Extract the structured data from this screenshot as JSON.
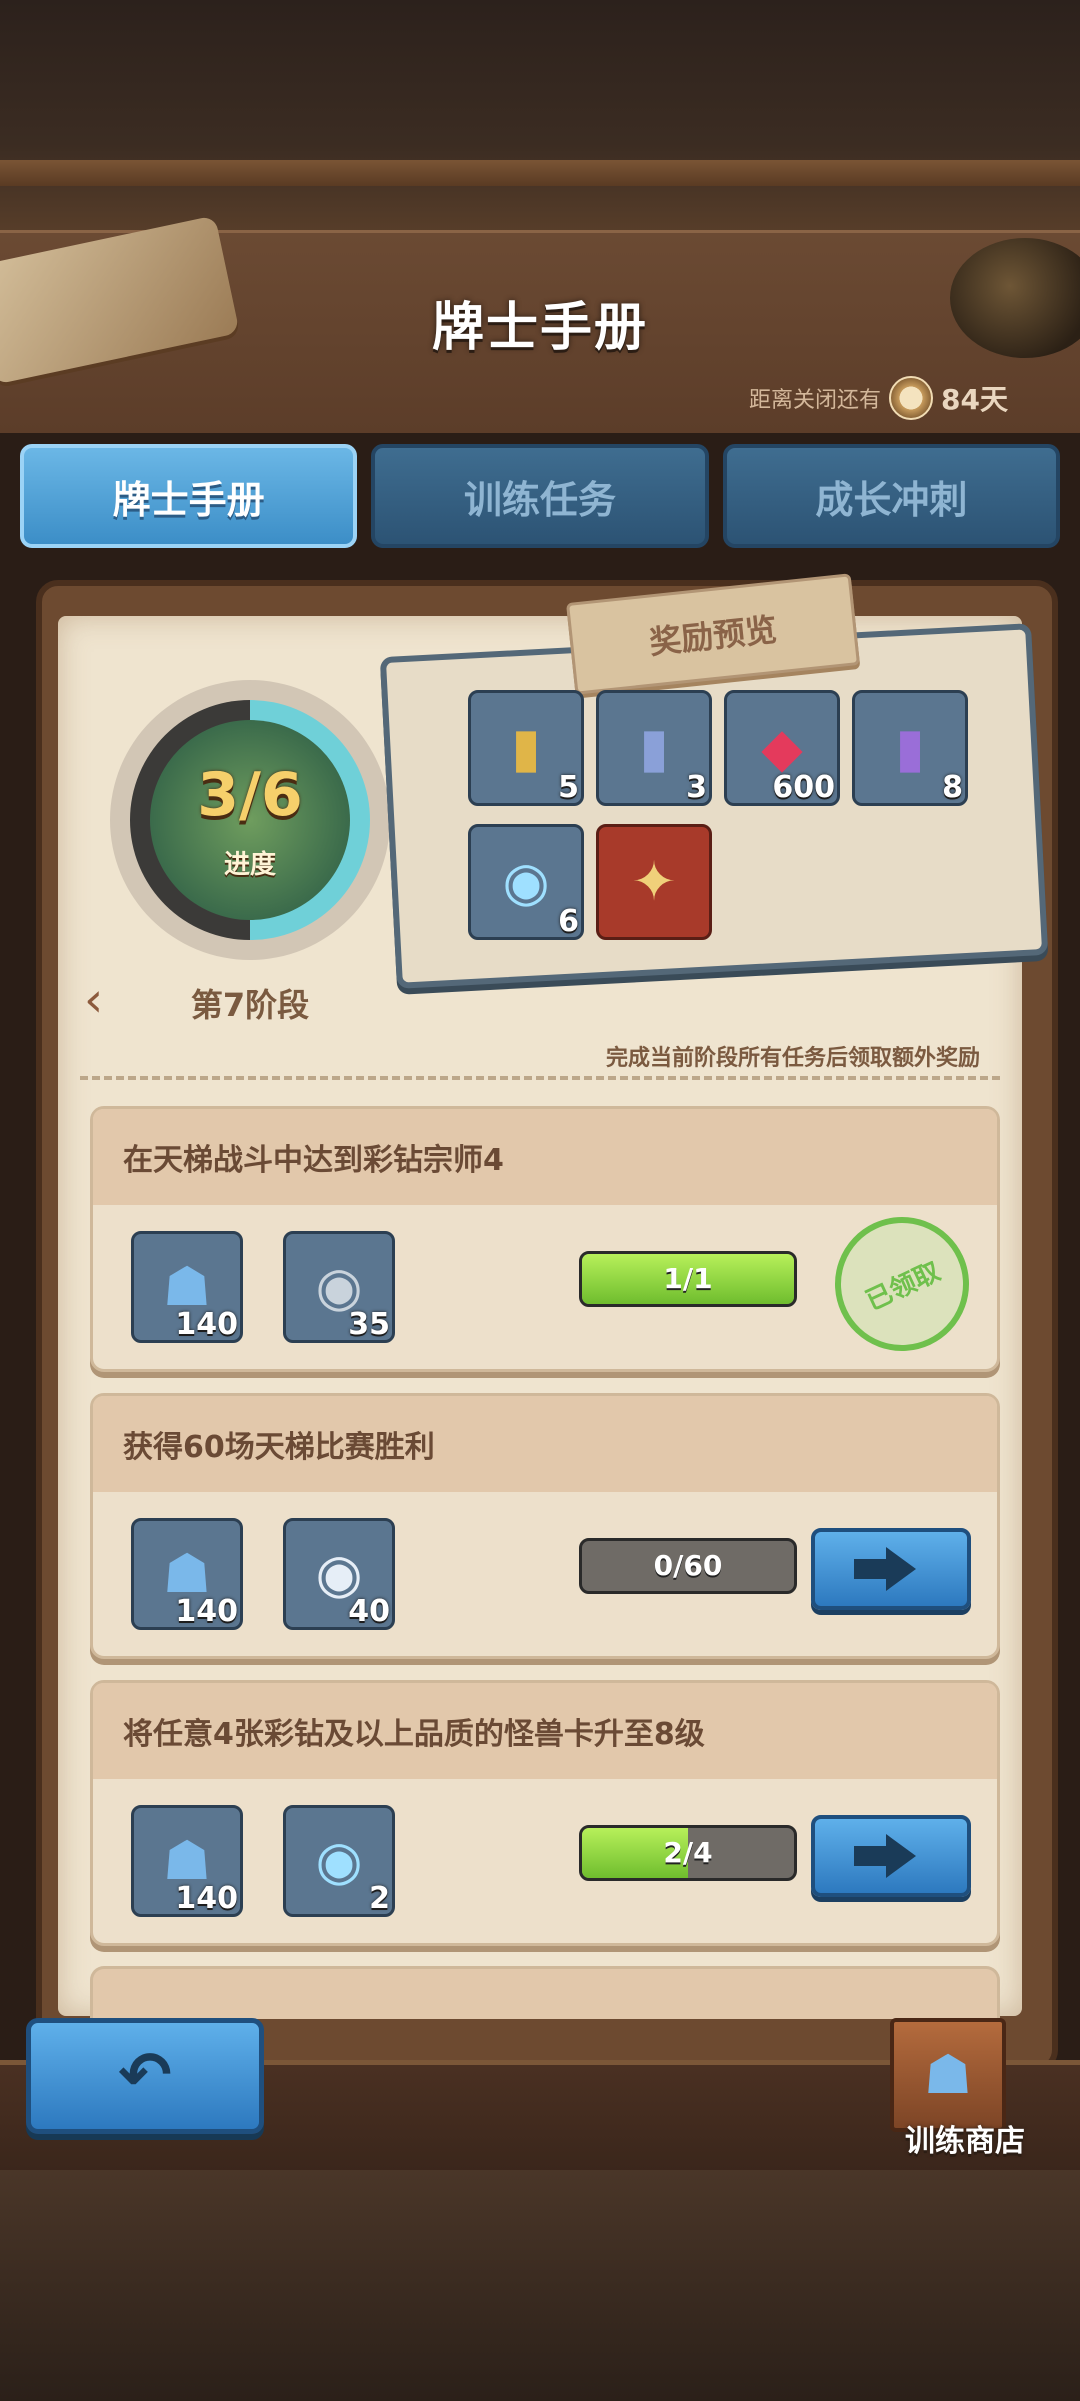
{
  "header": {
    "title": "牌士手册",
    "countdown_label": "距离关闭还有",
    "countdown_days": "84天"
  },
  "tabs": [
    {
      "label": "牌士手册",
      "active": true
    },
    {
      "label": "训练任务",
      "active": false
    },
    {
      "label": "成长冲刺",
      "active": false
    }
  ],
  "progress": {
    "value": "3/6",
    "label": "进度",
    "stage": "第7阶段"
  },
  "rewards_preview": {
    "title": "奖励预览",
    "items": [
      {
        "icon": "golden-card-pack-icon",
        "count": "5"
      },
      {
        "icon": "blue-gold-card-pack-icon",
        "count": "3"
      },
      {
        "icon": "red-gem-icon",
        "count": "600"
      },
      {
        "icon": "purple-card-pack-icon",
        "count": "8"
      },
      {
        "icon": "rainbow-diamond-icon",
        "count": "6"
      },
      {
        "icon": "monster-card-icon",
        "count": ""
      }
    ]
  },
  "hint": "完成当前阶段所有任务后领取额外奖励",
  "tasks": [
    {
      "title": "在天梯战斗中达到彩钻宗师4",
      "rewards": [
        {
          "icon": "trainer-token-icon",
          "count": "140"
        },
        {
          "icon": "dark-diamond-icon",
          "count": "35"
        }
      ],
      "progress_text": "1/1",
      "progress_ratio": 1.0,
      "status": "已领取"
    },
    {
      "title": "获得60场天梯比赛胜利",
      "rewards": [
        {
          "icon": "trainer-token-icon",
          "count": "140"
        },
        {
          "icon": "silver-diamond-icon",
          "count": "40"
        }
      ],
      "progress_text": "0/60",
      "progress_ratio": 0.0
    },
    {
      "title": "将任意4张彩钻及以上品质的怪兽卡升至8级",
      "rewards": [
        {
          "icon": "trainer-token-icon",
          "count": "140"
        },
        {
          "icon": "rainbow-diamond-icon",
          "count": "2"
        }
      ],
      "progress_text": "2/4",
      "progress_ratio": 0.5
    }
  ],
  "shop": {
    "label": "训练商店"
  },
  "colors": {
    "tab_active": "#3c8ec7",
    "progress_green": "#6fbd2e",
    "paper": "#efe4cf"
  }
}
